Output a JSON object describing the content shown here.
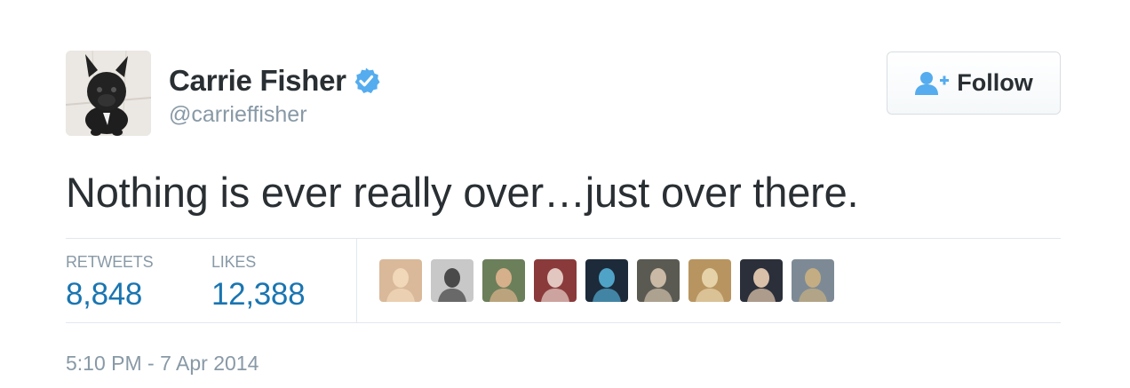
{
  "tweet": {
    "author": {
      "display_name": "Carrie Fisher",
      "screen_name": "@carrieffisher",
      "verified": true,
      "avatar_icon": "dog-photo-avatar"
    },
    "follow_button": {
      "label": "Follow",
      "icon": "follow-user-icon"
    },
    "text": "Nothing is ever really over…just over there.",
    "stats": {
      "retweets_label": "RETWEETS",
      "retweets_value": "8,848",
      "likes_label": "LIKES",
      "likes_value": "12,388"
    },
    "likers": [
      {
        "icon": "liker-avatar",
        "colors": [
          "#d9b99a",
          "#f0d8b8"
        ]
      },
      {
        "icon": "liker-avatar",
        "colors": [
          "#c8c8c8",
          "#4a4a4a"
        ]
      },
      {
        "icon": "liker-avatar",
        "colors": [
          "#6b7f5a",
          "#d6b08a"
        ]
      },
      {
        "icon": "liker-avatar",
        "colors": [
          "#8a3a3a",
          "#e2c7c0"
        ]
      },
      {
        "icon": "liker-avatar",
        "colors": [
          "#1d2a3a",
          "#4fa3c7"
        ]
      },
      {
        "icon": "liker-avatar",
        "colors": [
          "#5a5a52",
          "#c9b9a5"
        ]
      },
      {
        "icon": "liker-avatar",
        "colors": [
          "#b89560",
          "#e6d2a8"
        ]
      },
      {
        "icon": "liker-avatar",
        "colors": [
          "#2a2f3a",
          "#d9c0a8"
        ]
      },
      {
        "icon": "liker-avatar",
        "colors": [
          "#7d8a96",
          "#c4ad82"
        ]
      }
    ],
    "timestamp": "5:10 PM - 7 Apr 2014"
  },
  "colors": {
    "link_blue": "#1a75b1",
    "verified_blue": "#55acee",
    "muted_gray": "#8899a6",
    "text_dark": "#292f33",
    "border": "#e1e8ed"
  }
}
